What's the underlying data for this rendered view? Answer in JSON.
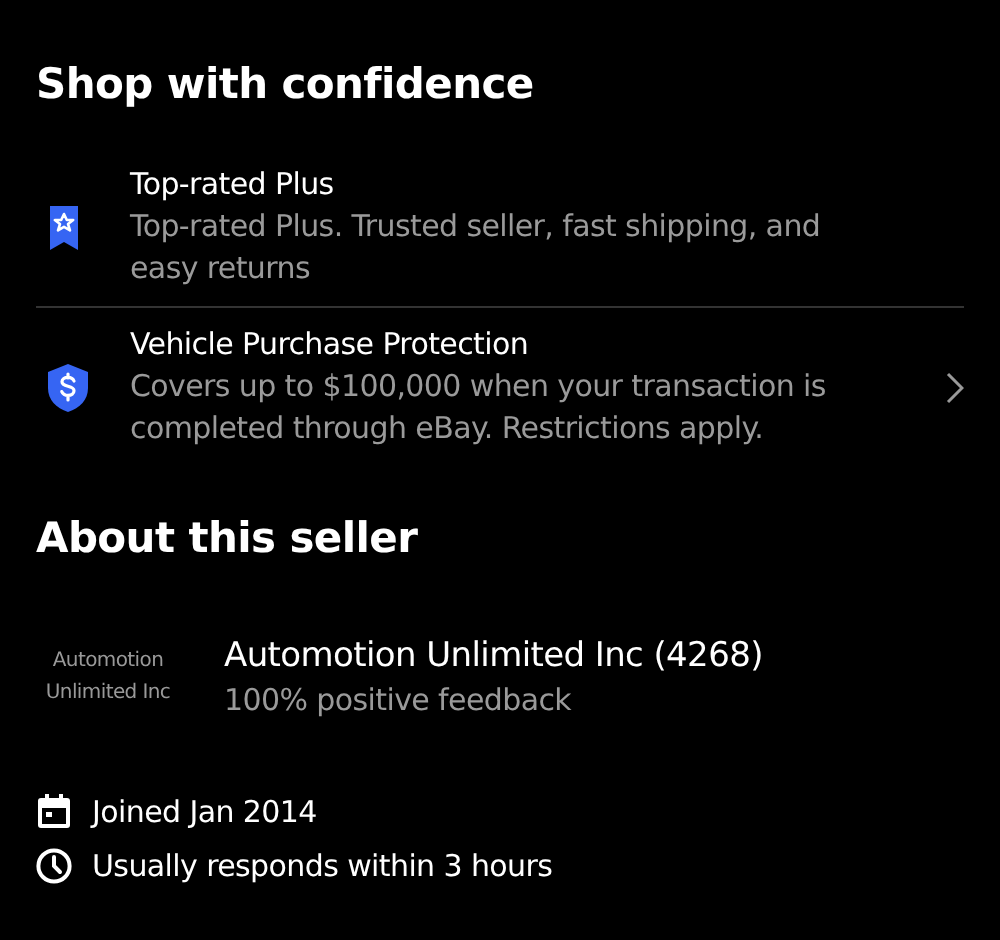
{
  "shop_section": {
    "title": "Shop with confidence",
    "features": [
      {
        "kind": "badge",
        "title": "Top-rated Plus",
        "description": "Top-rated Plus. Trusted seller, fast shipping, and easy returns",
        "has_chevron": false
      },
      {
        "kind": "shield",
        "title": "Vehicle Purchase Protection",
        "description": "Covers up to $100,000 when your transaction is completed through eBay. Restrictions apply.",
        "has_chevron": true
      }
    ]
  },
  "seller_section": {
    "title": "About this seller",
    "logo_text": "Automotion Unlimited Inc",
    "name": "Automotion Unlimited Inc (4268)",
    "feedback": "100% positive feedback",
    "facts": [
      {
        "kind": "calendar",
        "text": "Joined Jan 2014"
      },
      {
        "kind": "clock",
        "text": "Usually responds within 3 hours"
      }
    ]
  }
}
